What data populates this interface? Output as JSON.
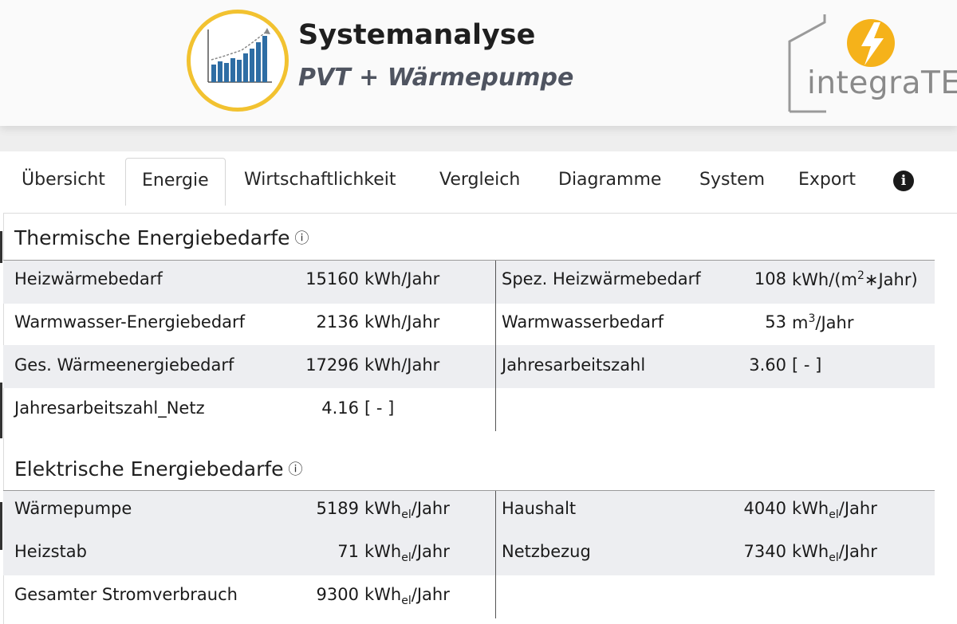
{
  "header": {
    "title": "Systemanalyse",
    "subtitle": "PVT + Wärmepumpe",
    "brand": "integraTE",
    "logo_icon": "bar-chart-trend-icon",
    "brand_icon": "sun-lightning-house-icon"
  },
  "tabs": [
    {
      "label": "Übersicht",
      "active": false
    },
    {
      "label": "Energie",
      "active": true
    },
    {
      "label": "Wirtschaftlichkeit",
      "active": false
    },
    {
      "label": "Vergleich",
      "active": false
    },
    {
      "label": "Diagramme",
      "active": false
    },
    {
      "label": "System",
      "active": false
    },
    {
      "label": "Export",
      "active": false
    }
  ],
  "info_tab_glyph": "i",
  "thermal": {
    "title": "Thermische Energiebedarfe",
    "info_glyph": "ⓘ",
    "rows": [
      {
        "l_label": "Heizwärmebedarf",
        "l_value": "15160",
        "l_unit": "kWh/Jahr",
        "r_label": "Spez. Heizwärmebedarf",
        "r_value": "108",
        "r_unit_a": "kWh/(m",
        "r_unit_sup": "2",
        "r_unit_b": "∗Jahr)"
      },
      {
        "l_label": "Warmwasser-Energiebedarf",
        "l_value": "2136",
        "l_unit": "kWh/Jahr",
        "r_label": "Warmwasserbedarf",
        "r_value": "53",
        "r_unit_a": "m",
        "r_unit_sup": "3",
        "r_unit_b": "/Jahr"
      },
      {
        "l_label": "Ges. Wärmeenergiebedarf",
        "l_value": "17296",
        "l_unit": "kWh/Jahr",
        "r_label": "Jahresarbeitszahl",
        "r_value": "3.60",
        "r_unit_a": "[ - ]",
        "r_unit_sup": "",
        "r_unit_b": ""
      },
      {
        "l_label": "Jahresarbeitszahl_Netz",
        "l_value": "4.16",
        "l_unit": "[ - ]"
      }
    ]
  },
  "electric": {
    "title": "Elektrische Energiebedarfe",
    "info_glyph": "ⓘ",
    "unit_base": "kWh",
    "unit_sub": "el",
    "unit_tail": "/Jahr",
    "rows": [
      {
        "l_label": "Wärmepumpe",
        "l_value": "5189",
        "r_label": "Haushalt",
        "r_value": "4040"
      },
      {
        "l_label": "Heizstab",
        "l_value": "71",
        "r_label": "Netzbezug",
        "r_value": "7340"
      },
      {
        "l_label": "Gesamter Stromverbrauch",
        "l_value": "9300"
      }
    ]
  },
  "colors": {
    "logo_ring": "#f2c230",
    "bars": "#2e6da4",
    "sun": "#f5b21a",
    "row_stripe": "#edeef1"
  }
}
